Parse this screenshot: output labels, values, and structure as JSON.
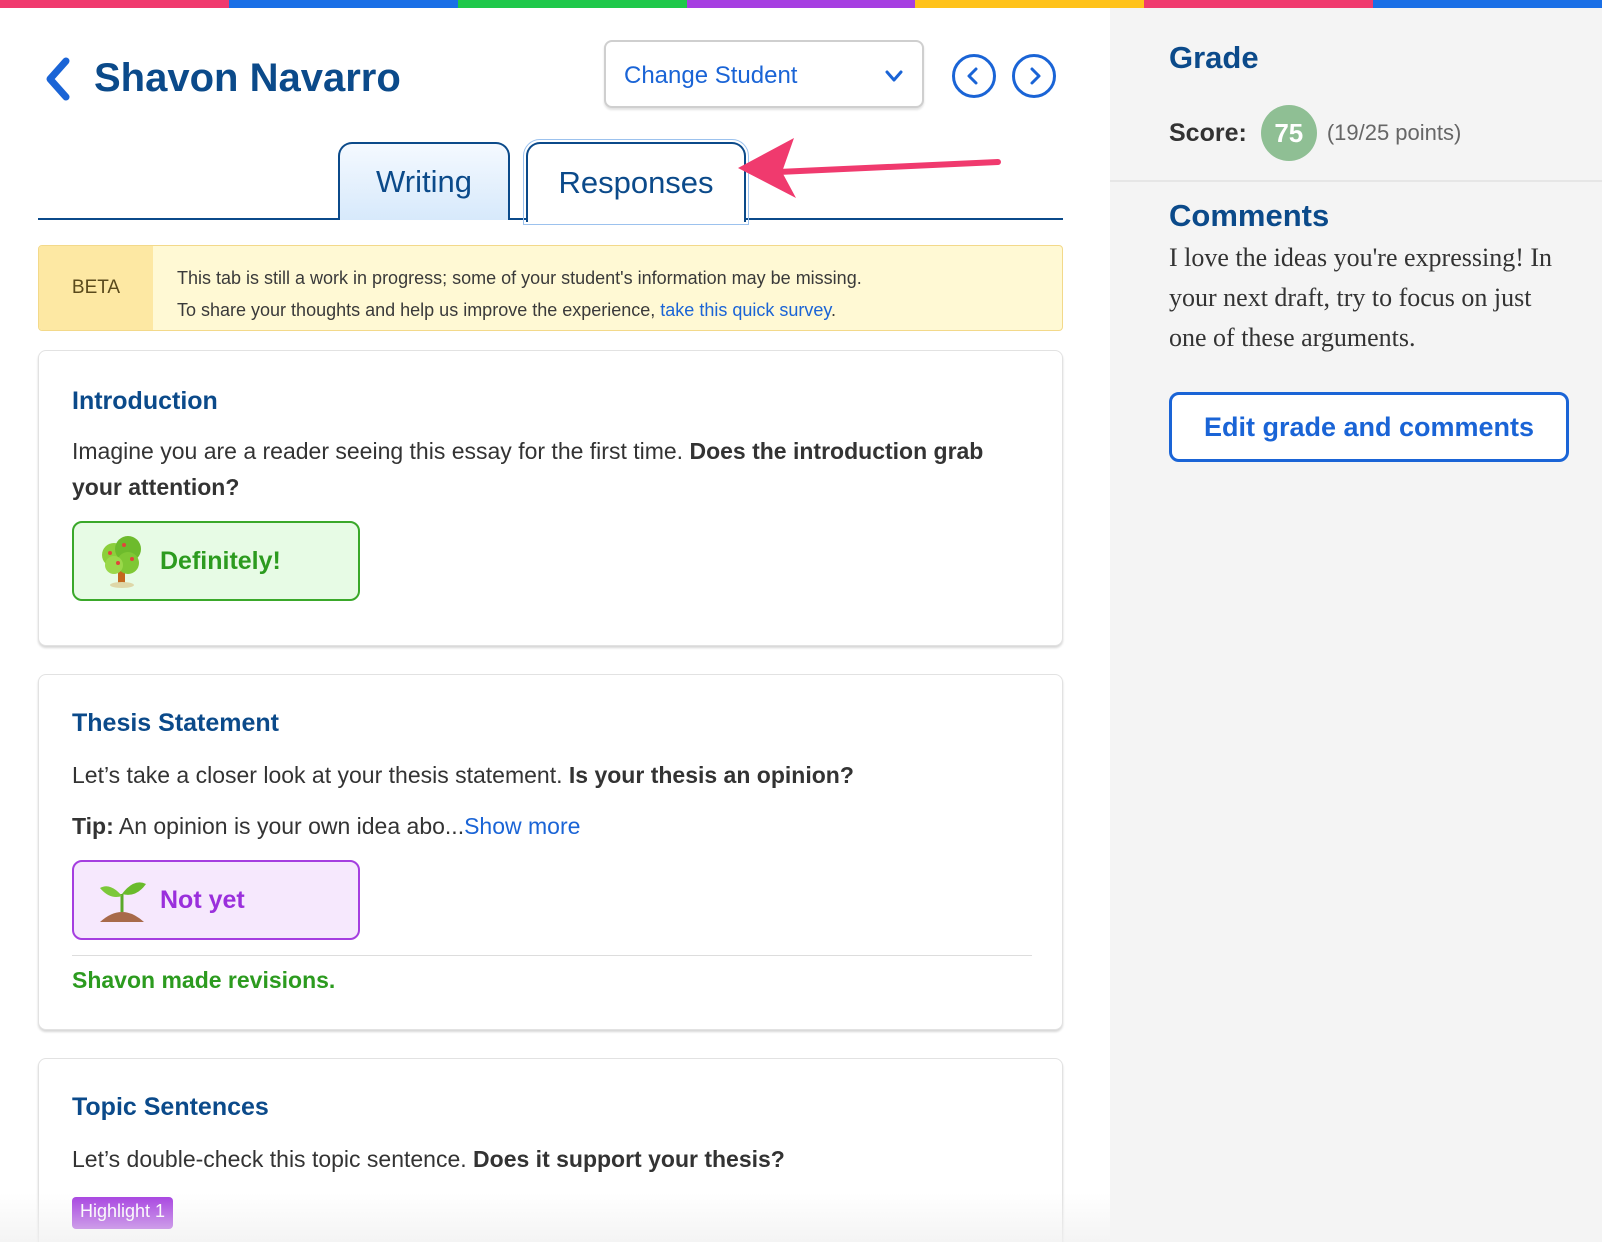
{
  "colors": {
    "stripe": [
      "#f03a6e",
      "#1a6fe6",
      "#1fc84a",
      "#a63fe1",
      "#ffc21a",
      "#f03a6e",
      "#1a6fe6"
    ],
    "navy": "#0b4a8a",
    "link_blue": "#1a64d6",
    "green": "#2c9b1f",
    "purple": "#9a2fdc",
    "annotation_arrow": "#f03a6e"
  },
  "header": {
    "back_icon": "chevron-left-icon",
    "student_name": "Shavon Navarro",
    "change_student_label": "Change Student",
    "change_student_icon": "chevron-down-icon",
    "prev_icon": "circle-chevron-left-icon",
    "next_icon": "circle-chevron-right-icon"
  },
  "tabs": [
    {
      "label": "Writing",
      "active": false
    },
    {
      "label": "Responses",
      "active": true
    }
  ],
  "beta_banner": {
    "label": "BETA",
    "line1": "This tab is still a work in progress; some of your student's information may be missing.",
    "line2_prefix": "To share your thoughts and help us improve the experience, ",
    "link_text": "take this quick survey",
    "line2_suffix": "."
  },
  "cards": [
    {
      "title": "Introduction",
      "prompt": "Imagine you are a reader seeing this essay for the first time. ",
      "question": "Does the introduction grab your attention?",
      "response_label": "Definitely!",
      "response_icon": "tree-icon"
    },
    {
      "title": "Thesis Statement",
      "prompt": "Let’s take a closer look at your thesis statement. ",
      "question": "Is your thesis an opinion?",
      "tip_label": "Tip:",
      "tip_text": " An opinion is your own idea abo...",
      "show_more": "Show more",
      "response_label": "Not yet",
      "response_icon": "sprout-icon",
      "revision_note": "Shavon made revisions."
    },
    {
      "title": "Topic Sentences",
      "prompt": "Let’s double-check this topic sentence. ",
      "question": "Does it support your thesis?",
      "badge": "Highlight 1"
    }
  ],
  "sidebar": {
    "grade_heading": "Grade",
    "score_label": "Score:",
    "score_value": "75",
    "score_points": "(19/25 points)",
    "comments_heading": "Comments",
    "comment": "I love the ideas you're expressing! In your next draft, try to focus on just one of these arguments.",
    "edit_button": "Edit grade and comments"
  }
}
